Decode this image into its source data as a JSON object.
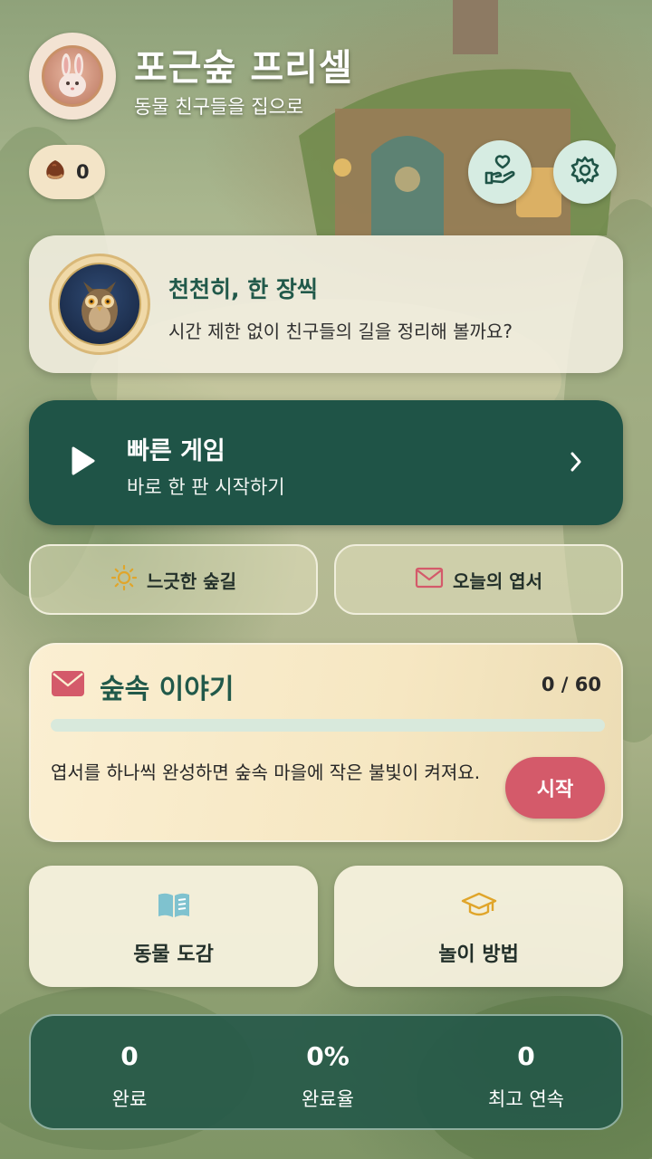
{
  "header": {
    "title": "포근숲 프리셀",
    "subtitle": "동물 친구들을 집으로",
    "chestnut_count": "0"
  },
  "owl_card": {
    "title": "천천히, 한 장씩",
    "text": "시간 제한 없이 친구들의 길을 정리해 볼까요?"
  },
  "quick_game": {
    "title": "빠른 게임",
    "subtitle": "바로 한 판 시작하기"
  },
  "pills": {
    "relaxed": "느긋한 숲길",
    "postcard": "오늘의 엽서"
  },
  "story": {
    "title": "숲속 이야기",
    "progress_text": "0 / 60",
    "progress_fraction": 0,
    "description": "엽서를 하나씩 완성하면 숲속 마을에 작은 불빛이 켜져요.",
    "start_label": "시작"
  },
  "tiles": {
    "guide": "동물 도감",
    "howto": "놀이 방법"
  },
  "stats": [
    {
      "value": "0",
      "label": "완료"
    },
    {
      "value": "0%",
      "label": "완료율"
    },
    {
      "value": "0",
      "label": "최고 연속"
    }
  ],
  "colors": {
    "primary_green": "#1f5447",
    "accent_red": "#d45a6a",
    "icon_teal": "#d6ece2",
    "sun_yellow": "#e0a52a",
    "book_blue": "#7fc2cf"
  }
}
